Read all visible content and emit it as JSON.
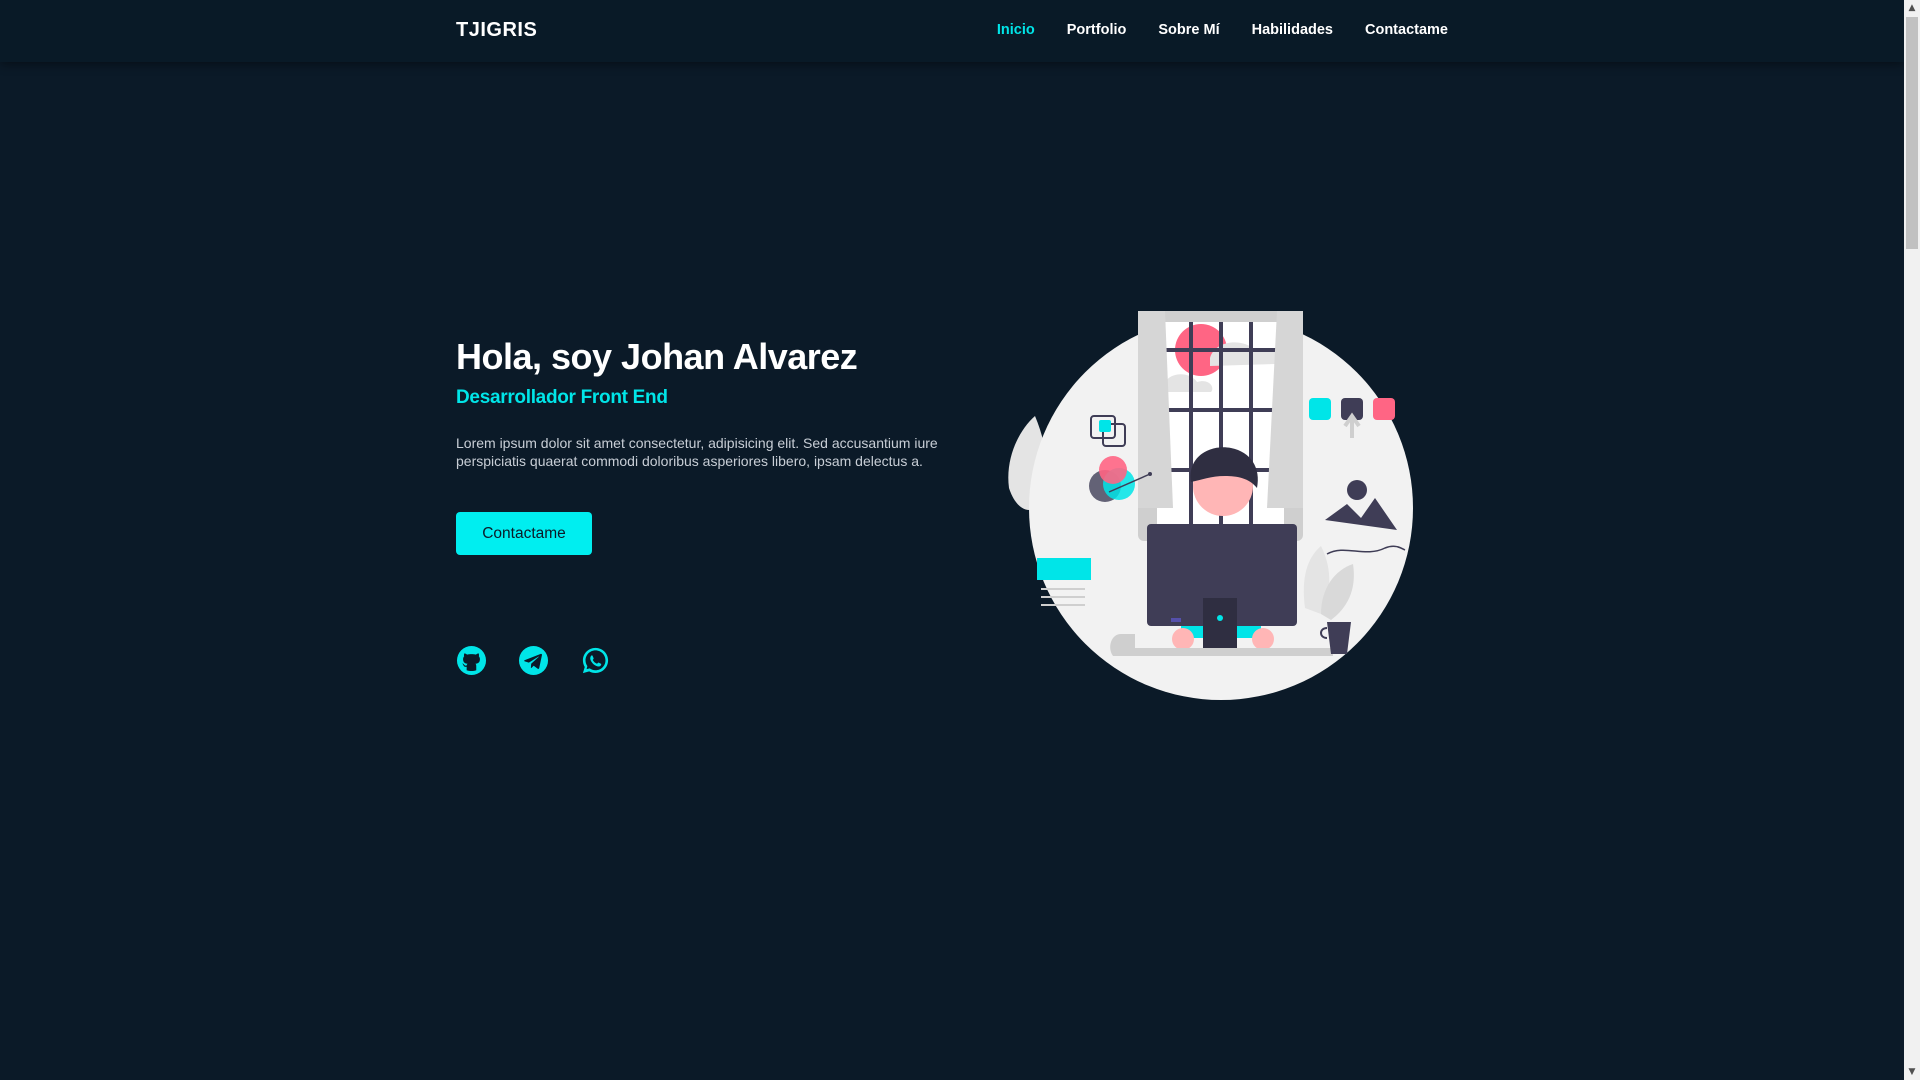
{
  "header": {
    "logo": "TJIGRIS",
    "nav": [
      {
        "label": "Inicio",
        "active": true
      },
      {
        "label": "Portfolio",
        "active": false
      },
      {
        "label": "Sobre Mí",
        "active": false
      },
      {
        "label": "Habilidades",
        "active": false
      },
      {
        "label": "Contactame",
        "active": false
      }
    ]
  },
  "hero": {
    "title": "Hola, soy Johan Alvarez",
    "subtitle": "Desarrollador Front End",
    "description": "Lorem ipsum dolor sit amet consectetur, adipisicing elit. Sed accusantium iure perspiciatis quaerat commodi doloribus asperiores libero, ipsam delectus a.",
    "cta_label": "Contactame",
    "socials": [
      "github-icon",
      "telegram-icon",
      "whatsapp-icon"
    ]
  },
  "colors": {
    "background": "#0b1a28",
    "accent": "#00e5e8",
    "highlight": "#ff6584",
    "text": "#ffffff"
  },
  "scrollbar": {
    "up_arrow": "▲",
    "down_arrow": "▼"
  }
}
